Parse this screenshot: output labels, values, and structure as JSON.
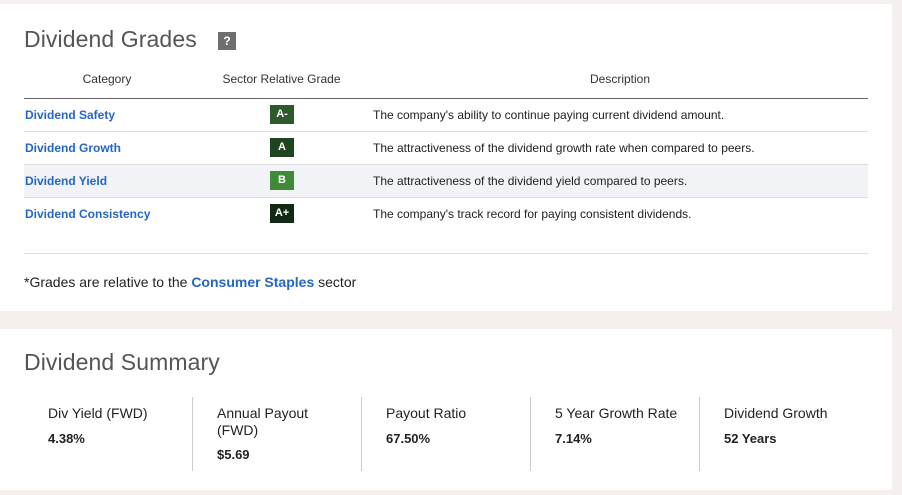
{
  "grades": {
    "title": "Dividend Grades",
    "help_label": "?",
    "columns": {
      "category": "Category",
      "grade": "Sector Relative Grade",
      "description": "Description"
    },
    "rows": [
      {
        "category": "Dividend Safety",
        "grade": "A-",
        "grade_color": "#2e5a2b",
        "description": "The company's ability to continue paying current dividend amount."
      },
      {
        "category": "Dividend Growth",
        "grade": "A",
        "grade_color": "#1f4420",
        "description": "The attractiveness of the dividend growth rate when compared to peers."
      },
      {
        "category": "Dividend Yield",
        "grade": "B",
        "grade_color": "#3f8a37",
        "description": "The attractiveness of the dividend yield compared to peers."
      },
      {
        "category": "Dividend Consistency",
        "grade": "A+",
        "grade_color": "#122a14",
        "description": "The company's track record for paying consistent dividends."
      }
    ],
    "footnote_prefix": "*Grades are relative to the ",
    "footnote_sector": "Consumer Staples",
    "footnote_suffix": " sector"
  },
  "summary": {
    "title": "Dividend Summary",
    "metrics": [
      {
        "label": "Div Yield (FWD)",
        "value": "4.38%"
      },
      {
        "label": "Annual Payout (FWD)",
        "value": "$5.69"
      },
      {
        "label": "Payout Ratio",
        "value": "67.50%"
      },
      {
        "label": "5 Year Growth Rate",
        "value": "7.14%"
      },
      {
        "label": "Dividend Growth",
        "value": "52 Years"
      }
    ]
  },
  "colors": {
    "link_blue": "#2566c4",
    "page_bg": "#f5f0ee",
    "card_bg": "#ffffff"
  }
}
